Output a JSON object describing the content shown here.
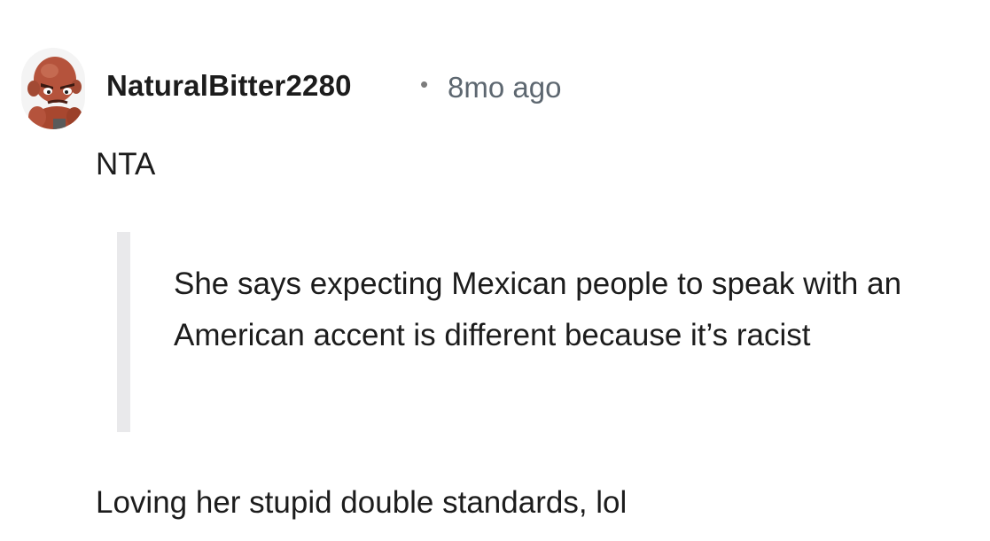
{
  "comment": {
    "author": {
      "username": "NaturalBitter2280",
      "avatar_icon": "snoo-avatar-icon"
    },
    "separator": "•",
    "timestamp": "8mo ago",
    "body": {
      "first_line": "NTA",
      "quote": "She says expecting Mexican people to speak with an American accent is different because it’s racist",
      "last_line": "Loving her stupid double standards, lol"
    }
  },
  "colors": {
    "background": "#ffffff",
    "text": "#1c1c1c",
    "meta_text": "#5d6770",
    "quote_bar": "#e9e9eb",
    "avatar_skin": "#b5533c"
  }
}
